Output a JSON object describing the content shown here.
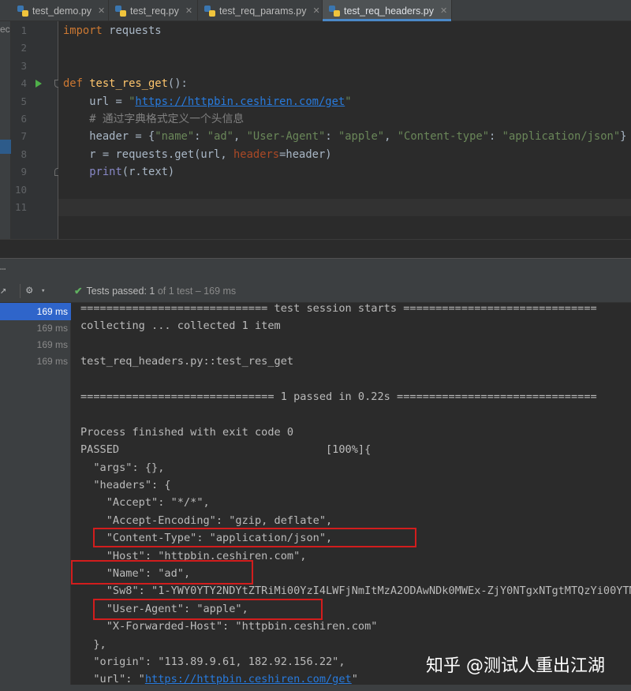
{
  "tabs": [
    {
      "label": "test_demo.py",
      "active": false
    },
    {
      "label": "test_req.py",
      "active": false
    },
    {
      "label": "test_req_params.py",
      "active": false
    },
    {
      "label": "test_req_headers.py",
      "active": true
    }
  ],
  "left_strip_text": "ec",
  "editor": {
    "line_numbers": [
      "1",
      "2",
      "3",
      "4",
      "5",
      "6",
      "7",
      "8",
      "9",
      "10",
      "11"
    ],
    "code": {
      "l1_kw": "import",
      "l1_rest": " requests",
      "l4_kw": "def",
      "l4_fn": "test_res_get",
      "l4_rest": "():",
      "l5_a": "    url = ",
      "l5_q1": "\"",
      "l5_url": "https://httpbin.ceshiren.com/get",
      "l5_q2": "\"",
      "l6_comment": "    # 通过字典格式定义一个头信息",
      "l7_a": "    header = {",
      "l7_s1": "\"name\"",
      "l7_c1": ": ",
      "l7_s2": "\"ad\"",
      "l7_c2": ", ",
      "l7_s3": "\"User-Agent\"",
      "l7_c3": ": ",
      "l7_s4": "\"apple\"",
      "l7_c4": ", ",
      "l7_s5": "\"Content-type\"",
      "l7_c5": ": ",
      "l7_s6": "\"application/json\"",
      "l7_end": "}",
      "l8_a": "    r = requests.get(url, ",
      "l8_param": "headers",
      "l8_b": "=header)",
      "l9_bi": "print",
      "l9_rest": "(r.text)"
    }
  },
  "run_panel": {
    "status_prefix": "Tests passed: ",
    "status_count": "1",
    "status_suffix": " of 1 test – 169 ms",
    "tree_rows": [
      "169 ms",
      "169 ms",
      "169 ms",
      "169 ms"
    ],
    "console": {
      "l1": "============================= test session starts ==============================",
      "l2": "collecting ... collected 1 item",
      "l4": "test_req_headers.py::test_res_get",
      "l6": "============================== 1 passed in 0.22s ===============================",
      "l8": "Process finished with exit code 0",
      "l9": "PASSED                                [100%]{",
      "l10": "  \"args\": {},",
      "l11": "  \"headers\": {",
      "l12": "    \"Accept\": \"*/*\",",
      "l13": "    \"Accept-Encoding\": \"gzip, deflate\",",
      "l14": "    \"Content-Type\": \"application/json\",",
      "l15": "    \"Host\": \"httpbin.ceshiren.com\",",
      "l16": "    \"Name\": \"ad\",",
      "l17": "    \"Sw8\": \"1-YWY0YTY2NDYtZTRiMi00YzI4LWFjNmItMzA2ODAwNDk0MWEx-ZjY0NTgxNTgtMTQzYi00YTM",
      "l18": "    \"User-Agent\": \"apple\",",
      "l19": "    \"X-Forwarded-Host\": \"httpbin.ceshiren.com\"",
      "l20": "  },",
      "l21": "  \"origin\": \"113.89.9.61, 182.92.156.22\",",
      "l22_a": "  \"url\": \"",
      "l22_link": "https://httpbin.ceshiren.com/get",
      "l22_b": "\""
    }
  },
  "watermark": "知乎 @测试人重出江湖",
  "colors": {
    "highlight_box": "#d21d1d",
    "active_tab_underline": "#4a88c7",
    "selected_row": "#2f65ca"
  }
}
